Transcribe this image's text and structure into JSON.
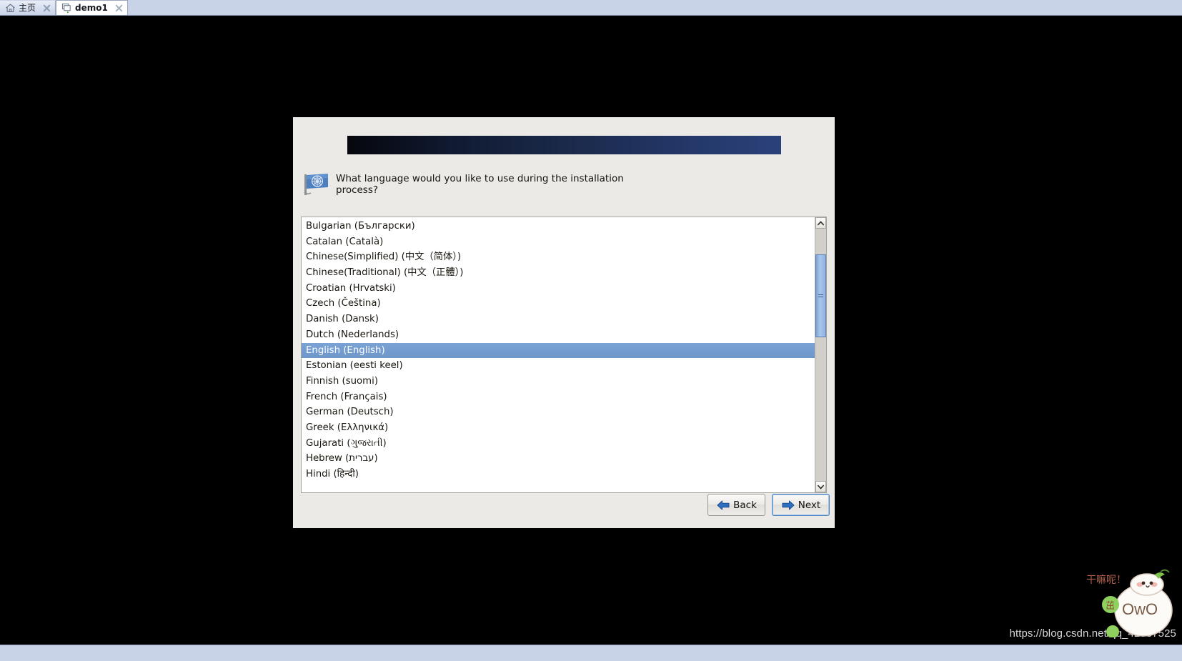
{
  "window": {
    "tabs": [
      {
        "label": "主页",
        "icon": "home-icon",
        "active": false,
        "close_icon": "close-icon"
      },
      {
        "label": "demo1",
        "icon": "virtual-machine-icon",
        "active": true,
        "close_icon": "close-icon"
      }
    ]
  },
  "installer": {
    "banner_title": "",
    "prompt_icon": "un-flag-icon",
    "prompt": "What language would you like to use during the installation process?",
    "languages": [
      "Bulgarian (Български)",
      "Catalan (Català)",
      "Chinese(Simplified) (中文（简体）)",
      "Chinese(Traditional) (中文（正體）)",
      "Croatian (Hrvatski)",
      "Czech (Čeština)",
      "Danish (Dansk)",
      "Dutch (Nederlands)",
      "English (English)",
      "Estonian (eesti keel)",
      "Finnish (suomi)",
      "French (Français)",
      "German (Deutsch)",
      "Greek (Ελληνικά)",
      "Gujarati (ગુજરાતી)",
      "Hebrew (עברית)",
      "Hindi (हिन्दी)"
    ],
    "selected_language": "English (English)",
    "scrollbar": {
      "up_arrow_icon": "chevron-up-icon",
      "down_arrow_icon": "chevron-down-icon",
      "grip_icon": "grip-lines-icon"
    },
    "buttons": {
      "back": {
        "label": "Back",
        "icon": "arrow-left-icon",
        "focused": false
      },
      "next": {
        "label": "Next",
        "icon": "arrow-right-icon",
        "focused": true
      }
    }
  },
  "overlay": {
    "watermark_url": "https://blog.csdn.net/qq_42987525",
    "sticker_text": "干嘛呢！",
    "sticker_face": "OwO"
  },
  "colors": {
    "selection_blue": "#6d96cb",
    "banner_navy": "#1b2a4c",
    "dialog_bg": "#eceae7",
    "tabbar_blue": "#c9d3e8",
    "focus_border": "#5186c5"
  }
}
